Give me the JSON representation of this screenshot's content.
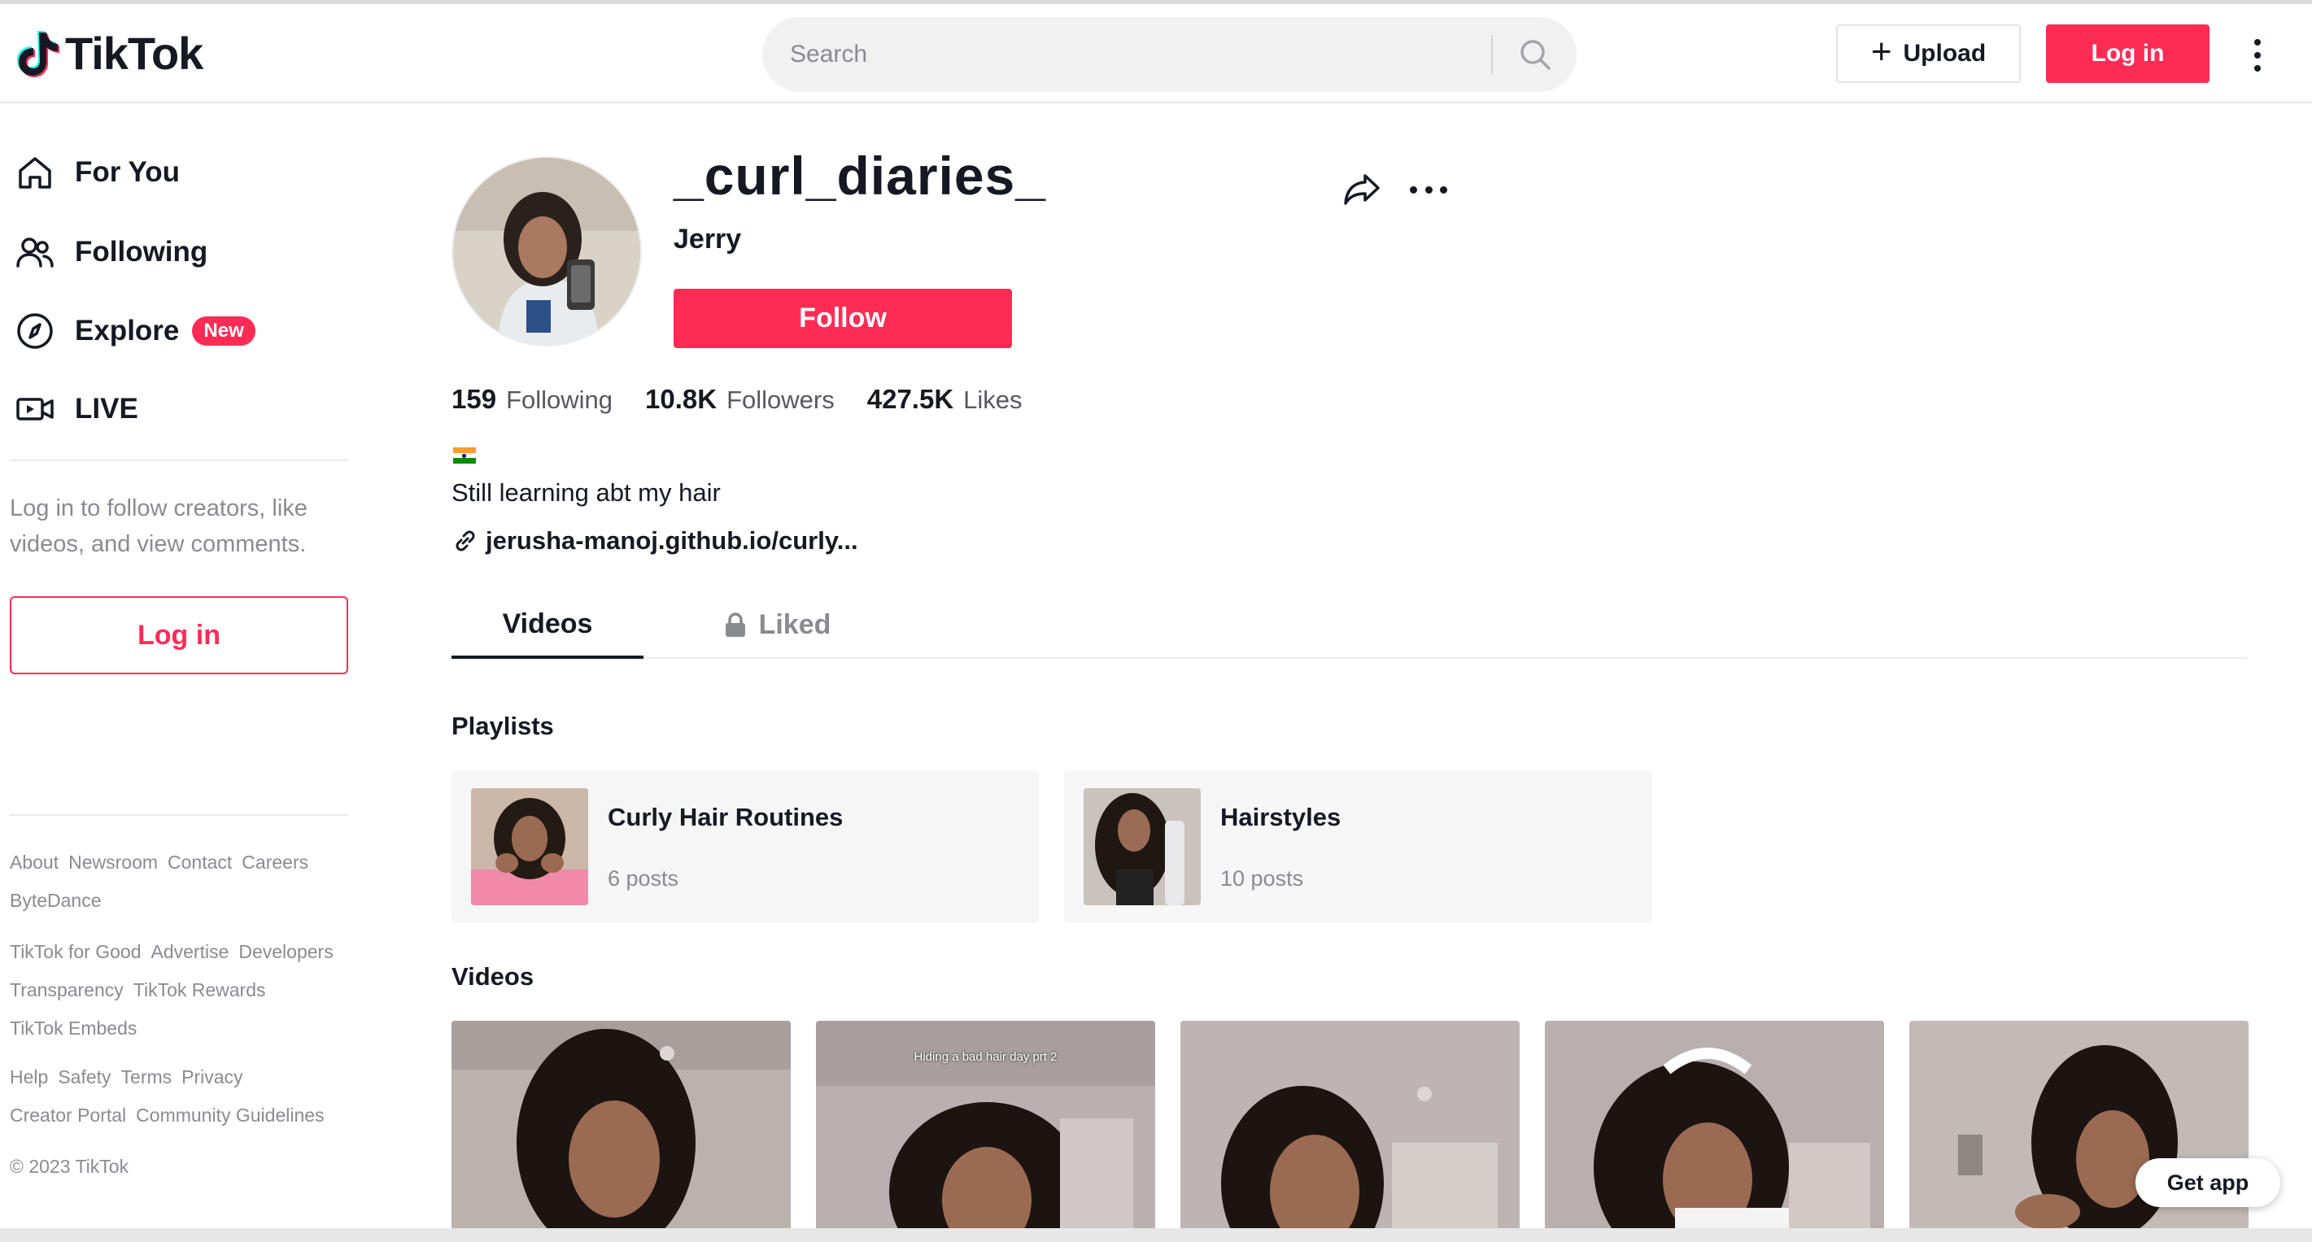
{
  "header": {
    "logo_text": "TikTok",
    "search_placeholder": "Search",
    "upload_label": "Upload",
    "login_label": "Log in"
  },
  "sidebar": {
    "nav": [
      {
        "label": "For You",
        "icon": "home-icon"
      },
      {
        "label": "Following",
        "icon": "users-icon"
      },
      {
        "label": "Explore",
        "icon": "compass-icon",
        "badge": "New"
      },
      {
        "label": "LIVE",
        "icon": "live-camera-icon"
      }
    ],
    "hint": "Log in to follow creators, like videos, and view comments.",
    "login_label": "Log in",
    "footer_groups": [
      [
        "About",
        "Newsroom",
        "Contact",
        "Careers",
        "ByteDance"
      ],
      [
        "TikTok for Good",
        "Advertise",
        "Developers",
        "Transparency",
        "TikTok Rewards",
        "TikTok Embeds"
      ],
      [
        "Help",
        "Safety",
        "Terms",
        "Privacy",
        "Creator Portal",
        "Community Guidelines"
      ]
    ],
    "copyright": "© 2023 TikTok"
  },
  "profile": {
    "username": "_curl_diaries_",
    "nickname": "Jerry",
    "follow_label": "Follow",
    "stats": [
      {
        "value": "159",
        "label": "Following"
      },
      {
        "value": "10.8K",
        "label": "Followers"
      },
      {
        "value": "427.5K",
        "label": "Likes"
      }
    ],
    "flag": "India flag",
    "bio": "Still learning abt my hair",
    "link": "jerusha-manoj.github.io/curly..."
  },
  "tabs": [
    {
      "label": "Videos",
      "active": true
    },
    {
      "label": "Liked",
      "locked": true
    }
  ],
  "playlists_title": "Playlists",
  "playlists": [
    {
      "title": "Curly Hair Routines",
      "count": "6 posts"
    },
    {
      "title": "Hairstyles",
      "count": "10 posts"
    }
  ],
  "videos_title": "Videos",
  "videos": [
    {
      "caption": ""
    },
    {
      "caption": "Hiding a bad hair day prt 2"
    },
    {
      "caption": ""
    },
    {
      "caption": ""
    },
    {
      "caption": ""
    }
  ],
  "get_app_label": "Get app",
  "colors": {
    "accent": "#fe2c55",
    "text": "#161823",
    "muted": "#8a8b91"
  }
}
